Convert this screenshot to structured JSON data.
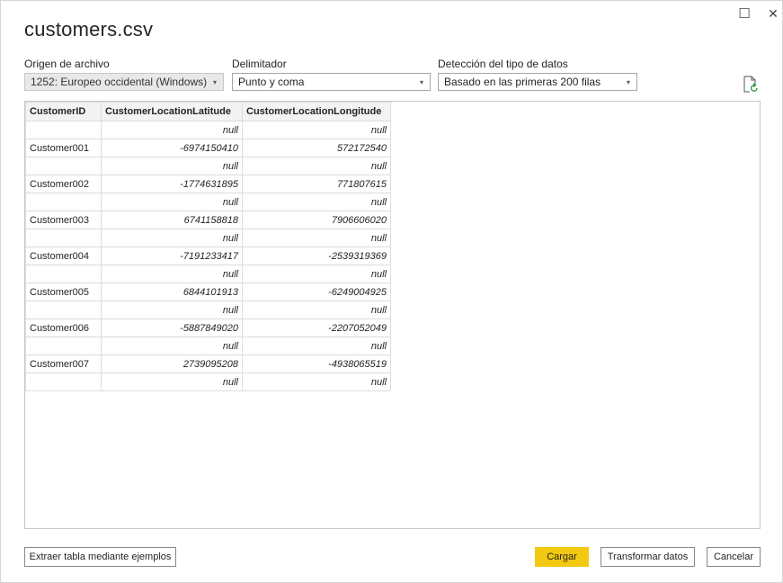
{
  "window": {
    "title": "customers.csv",
    "maximize_glyph": "☐",
    "close_glyph": "✕"
  },
  "options": {
    "file_origin": {
      "label": "Origen de archivo",
      "value": "1252: Europeo occidental (Windows)"
    },
    "delimiter": {
      "label": "Delimitador",
      "value": "Punto y coma"
    },
    "type_detection": {
      "label": "Detección del tipo de datos",
      "value": "Basado en las primeras 200 filas"
    },
    "caret": "▾"
  },
  "table": {
    "columns": [
      "CustomerID",
      "CustomerLocationLatitude",
      "CustomerLocationLongitude"
    ],
    "rows": [
      [
        "",
        "null",
        "null"
      ],
      [
        "Customer001",
        "-6974150410",
        "572172540"
      ],
      [
        "",
        "null",
        "null"
      ],
      [
        "Customer002",
        "-1774631895",
        "771807615"
      ],
      [
        "",
        "null",
        "null"
      ],
      [
        "Customer003",
        "6741158818",
        "7906606020"
      ],
      [
        "",
        "null",
        "null"
      ],
      [
        "Customer004",
        "-7191233417",
        "-2539319369"
      ],
      [
        "",
        "null",
        "null"
      ],
      [
        "Customer005",
        "6844101913",
        "-6249004925"
      ],
      [
        "",
        "null",
        "null"
      ],
      [
        "Customer006",
        "-5887849020",
        "-2207052049"
      ],
      [
        "",
        "null",
        "null"
      ],
      [
        "Customer007",
        "2739095208",
        "-4938065519"
      ],
      [
        "",
        "null",
        "null"
      ]
    ]
  },
  "footer": {
    "extract": "Extraer tabla mediante ejemplos",
    "load": "Cargar",
    "transform": "Transformar datos",
    "cancel": "Cancelar"
  },
  "colors": {
    "primary_button": "#f2c811",
    "refresh_icon": "#2b9a3c"
  }
}
